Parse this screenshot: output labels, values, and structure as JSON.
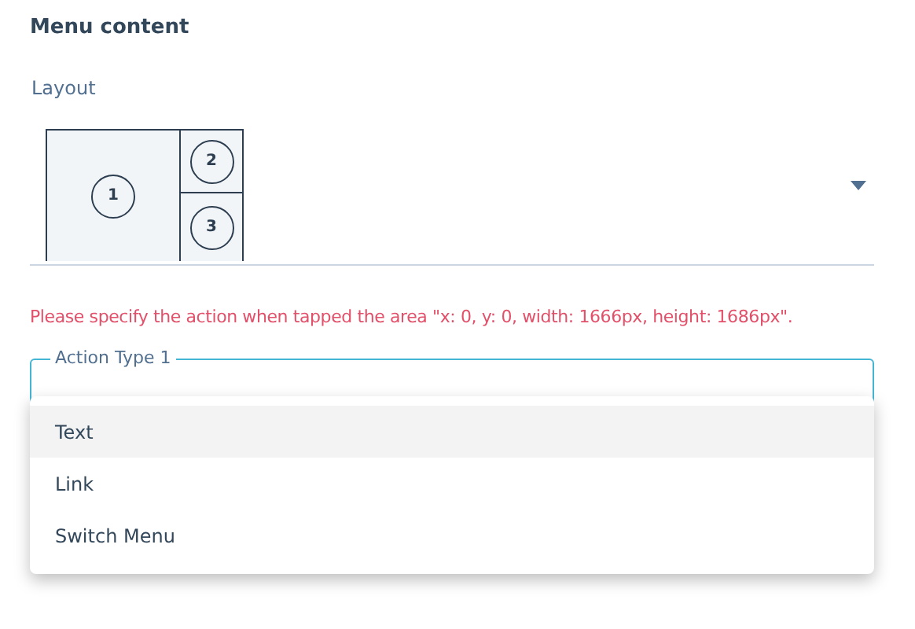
{
  "section_title": "Menu content",
  "layout_select": {
    "label": "Layout",
    "cells": [
      {
        "number": "1"
      },
      {
        "number": "2"
      },
      {
        "number": "3"
      }
    ]
  },
  "error_message": "Please specify the action when tapped the area \"x: 0, y: 0, width: 1666px, height: 1686px\".",
  "action_field": {
    "label": "Action Type 1",
    "focused": true
  },
  "dropdown_options": [
    {
      "label": "Text",
      "selected": true
    },
    {
      "label": "Link",
      "selected": false
    },
    {
      "label": "Switch Menu",
      "selected": false
    }
  ]
}
